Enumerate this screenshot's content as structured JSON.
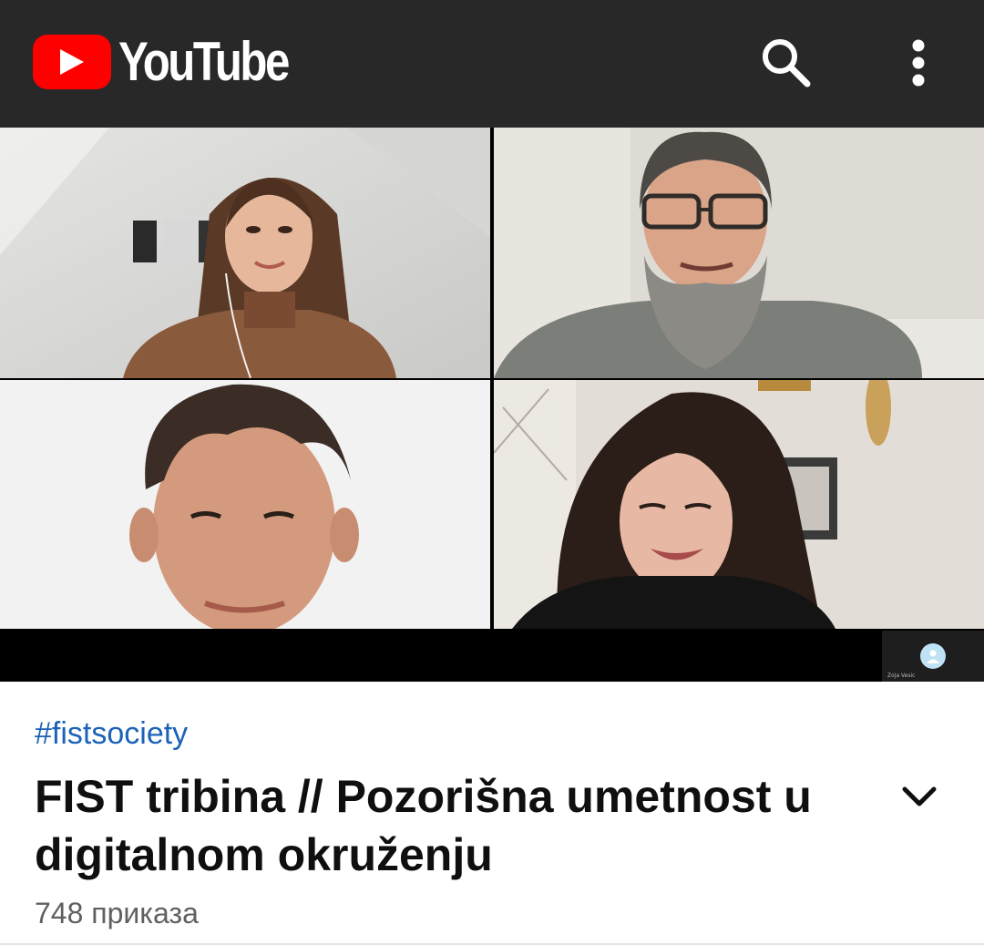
{
  "appbar": {
    "logo_text": "YouTube",
    "icons": [
      "play-logo-icon",
      "search-icon",
      "more-vert-icon"
    ]
  },
  "video": {
    "participants": [
      "participant-1",
      "participant-2",
      "participant-3",
      "participant-4"
    ],
    "self_view_label": "Zoja Vesic"
  },
  "info": {
    "hashtag": "#fistsociety",
    "title": "FIST tribina // Pozorišna umetnost u digitalnom okruženju",
    "views": "748 приказа"
  },
  "colors": {
    "appbar_bg": "#282828",
    "brand_red": "#ff0000",
    "hashtag": "#1c62b9",
    "title": "#0f0f0f",
    "meta": "#606060"
  }
}
